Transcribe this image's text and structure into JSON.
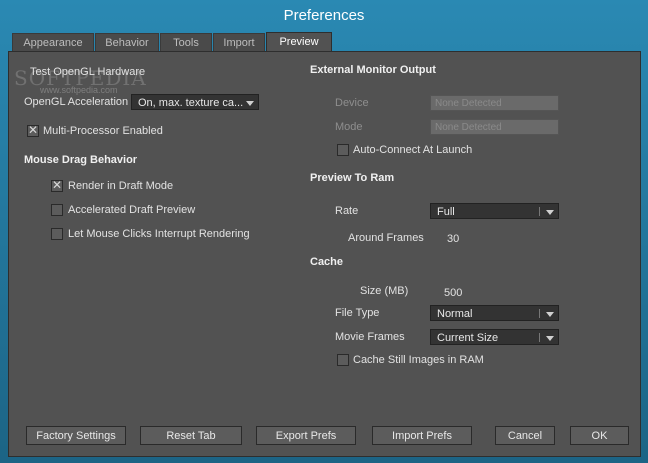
{
  "window": {
    "title": "Preferences"
  },
  "tabs": [
    {
      "label": "Appearance",
      "active": false
    },
    {
      "label": "Behavior",
      "active": false
    },
    {
      "label": "Tools",
      "active": false
    },
    {
      "label": "Import",
      "active": false
    },
    {
      "label": "Preview",
      "active": true
    }
  ],
  "watermark": {
    "brand": "SOFTPEDIA",
    "url": "www.softpedia.com"
  },
  "left": {
    "test_opengl_label": "Test OpenGL Hardware",
    "opengl_label": "OpenGL Acceleration",
    "opengl_value": "On, max. texture ca...",
    "multiprocessor_label": "Multi-Processor Enabled",
    "multiprocessor_checked": true,
    "mouse_drag_header": "Mouse Drag Behavior",
    "draft_mode_label": "Render in Draft Mode",
    "draft_mode_checked": true,
    "accel_draft_label": "Accelerated Draft Preview",
    "accel_draft_checked": false,
    "interrupt_label": "Let Mouse Clicks Interrupt Rendering",
    "interrupt_checked": false
  },
  "right": {
    "external_header": "External Monitor Output",
    "device_label": "Device",
    "device_value": "None Detected",
    "mode_label": "Mode",
    "mode_value": "None Detected",
    "autoconnect_label": "Auto-Connect At Launch",
    "autoconnect_checked": false,
    "preview_ram_header": "Preview To Ram",
    "rate_label": "Rate",
    "rate_value": "Full",
    "around_frames_label": "Around Frames",
    "around_frames_value": "30",
    "cache_header": "Cache",
    "size_label": "Size (MB)",
    "size_value": "500",
    "file_type_label": "File Type",
    "file_type_value": "Normal",
    "movie_frames_label": "Movie Frames",
    "movie_frames_value": "Current Size",
    "cache_still_label": "Cache Still Images in RAM",
    "cache_still_checked": false
  },
  "buttons": {
    "factory": "Factory Settings",
    "reset": "Reset Tab",
    "export": "Export Prefs",
    "import": "Import Prefs",
    "cancel": "Cancel",
    "ok": "OK"
  },
  "colors": {
    "frame": "#1e6b8c",
    "panel": "#525252",
    "dropdown": "#333333"
  }
}
